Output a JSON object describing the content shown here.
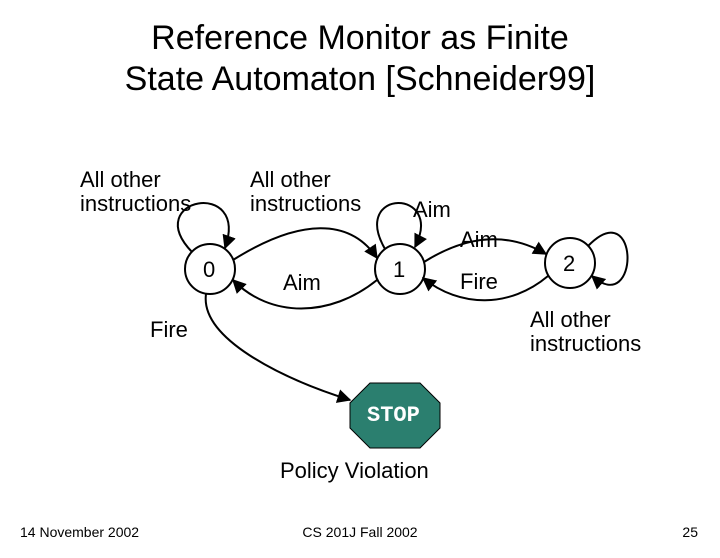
{
  "title": {
    "line1": "Reference Monitor as Finite",
    "line2": "State Automaton [Schneider99]"
  },
  "labels": {
    "allOther0": "All other\ninstructions",
    "allOther1": "All other\ninstructions",
    "allOther2": "All other\ninstructions",
    "aim_top": "Aim",
    "aim_bottom": "Aim",
    "aim_back": "Aim",
    "fire_back": "Fire",
    "fire_down": "Fire"
  },
  "states": {
    "s0": "0",
    "s1": "1",
    "s2": "2"
  },
  "stop": "STOP",
  "policy": "Policy Violation",
  "footer": {
    "left": "14 November 2002",
    "center": "CS 201J Fall 2002",
    "right": "25"
  },
  "colors": {
    "stopFill": "#2b7f6f",
    "stopStroke": "#000000"
  }
}
